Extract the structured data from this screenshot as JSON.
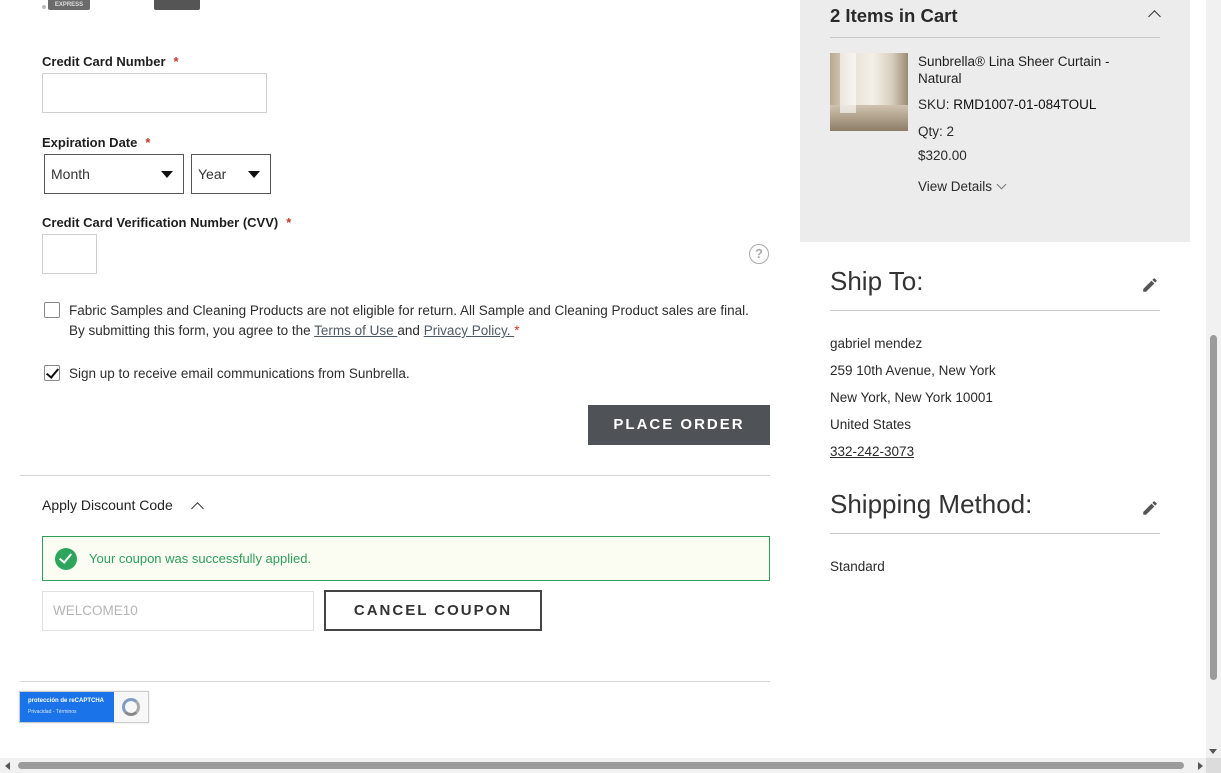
{
  "payment": {
    "card_logos": [
      "amex-logo",
      "visa-logo",
      "mastercard-logo"
    ],
    "amex_text": "EXPRESS",
    "visa_text": "VISA",
    "card_number_label": "Credit Card Number",
    "card_number_value": "",
    "expiration_label": "Expiration Date",
    "month_value": "Month",
    "year_value": "Year",
    "cvv_label": "Credit Card Verification Number (CVV)",
    "cvv_value": "",
    "required_mark": "*",
    "help_icon": "?"
  },
  "agreements": {
    "terms_text_1": "Fabric Samples and Cleaning Products are not eligible for return. All Sample and Cleaning Product sales are final. By submitting this form, you agree to the ",
    "terms_link": "Terms of Use ",
    "terms_and": "and ",
    "privacy_link": "Privacy Policy. ",
    "terms_required": "*",
    "terms_checked": false,
    "signup_text": "Sign up to receive email communications from Sunbrella.",
    "signup_checked": true
  },
  "place_order_label": "PLACE ORDER",
  "discount": {
    "title": "Apply Discount Code",
    "success_message": "Your coupon was successfully applied.",
    "code_value": "WELCOME10",
    "cancel_label": "CANCEL COUPON"
  },
  "recaptcha": {
    "line1": "protección de reCAPTCHA",
    "line2": "Privacidad - Términos"
  },
  "cart": {
    "title": "2 Items in Cart",
    "product_name": "Sunbrella® Lina Sheer Curtain - Natural",
    "sku_label": "SKU:",
    "sku_value": "RMD1007-01-084TOUL",
    "qty_text": "Qty: 2",
    "price": "$320.00",
    "view_details": "View Details"
  },
  "ship_to": {
    "title": "Ship To:",
    "name": "gabriel mendez",
    "street": "259 10th Avenue, New York",
    "city_line": "New York, New York 10001",
    "country": "United States",
    "phone": "332-242-3073"
  },
  "shipping_method": {
    "title": "Shipping Method:",
    "value": "Standard"
  },
  "colors": {
    "accent_button": "#4f5358",
    "success_green": "#2e9e5b",
    "cart_panel_bg": "#ececec",
    "required_red": "#c0392b"
  }
}
